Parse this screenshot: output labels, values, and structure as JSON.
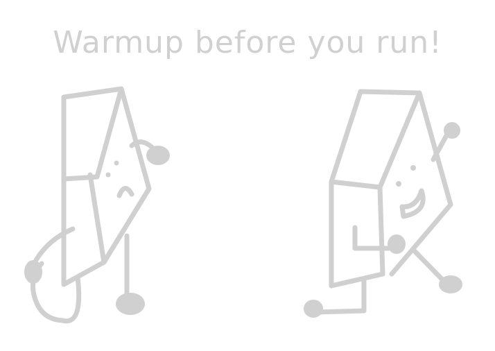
{
  "caption": "Warmup before you run!",
  "colors": {
    "ink": "#d0d0d0",
    "background": "#ffffff"
  },
  "characters": [
    {
      "name": "left-character",
      "expression": "frown"
    },
    {
      "name": "right-character",
      "expression": "smile"
    }
  ]
}
